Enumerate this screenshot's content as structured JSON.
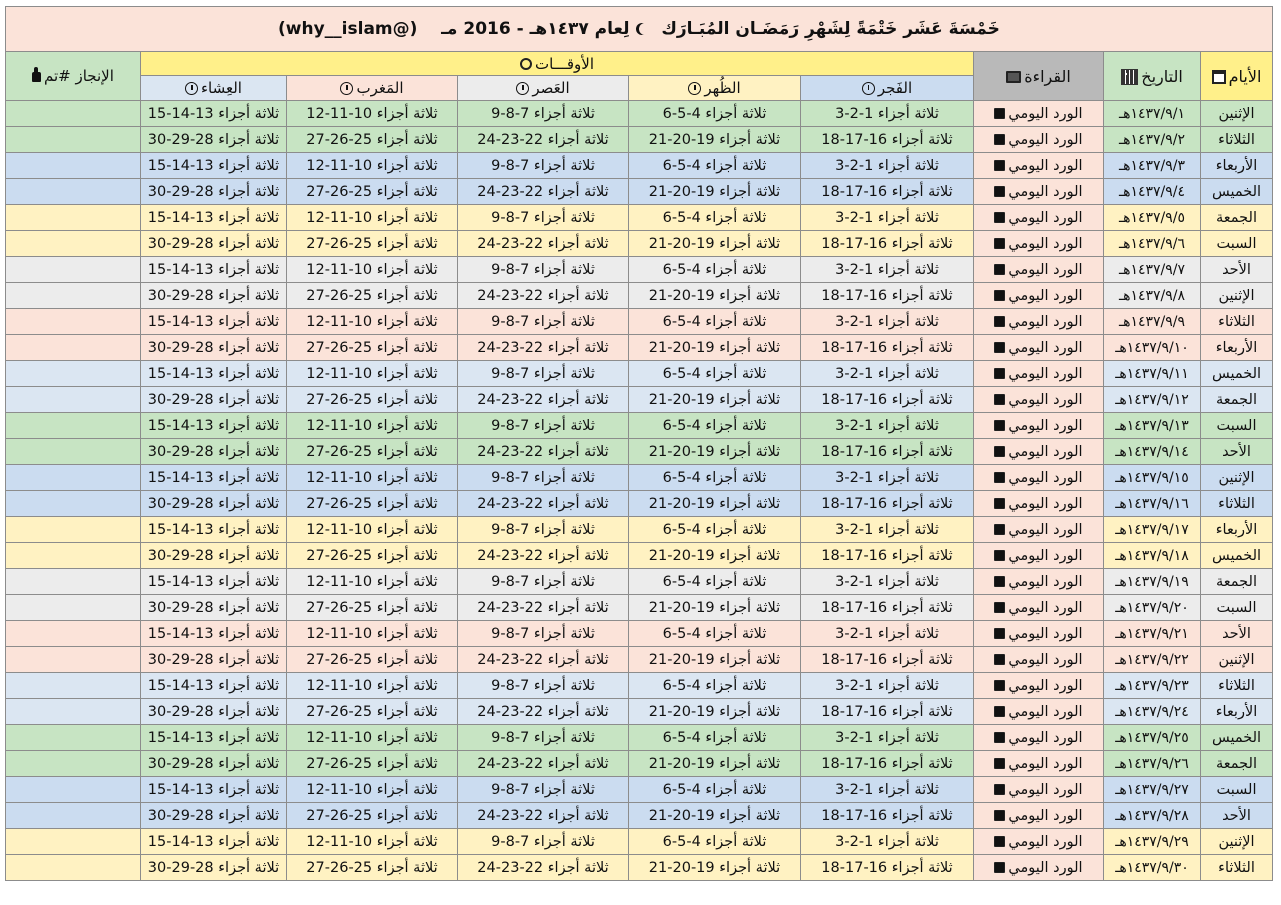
{
  "title": {
    "arabic": "خَمْسَةَ عَشَر خَتْمَةً لِشَهْرِ رَمَضَـان المُبَـارَك",
    "year_text": "لِعام ١٤٣٧هـ - 2016 مـ",
    "handle": "(@why__islam)"
  },
  "headers": {
    "day": "الأيام",
    "date": "التاريخ",
    "reading": "القراءة",
    "times": "الأوقـــات",
    "done": "الإنجاز #تم",
    "fajr": "الفَجر",
    "dhuhr": "الظُهر",
    "asr": "العَصر",
    "maghrib": "المَغرب",
    "isha": "العِشاء"
  },
  "reading_label": "الورد اليومي",
  "odd_row": {
    "fajr": "ثلاثة أجزاء 1-2-3",
    "dhuhr": "ثلاثة أجزاء 4-5-6",
    "asr": "ثلاثة أجزاء 7-8-9",
    "maghrib": "ثلاثة أجزاء 10-11-12",
    "isha": "ثلاثة أجزاء 13-14-15"
  },
  "even_row": {
    "fajr": "ثلاثة أجزاء 16-17-18",
    "dhuhr": "ثلاثة أجزاء 19-20-21",
    "asr": "ثلاثة أجزاء 22-23-24",
    "maghrib": "ثلاثة أجزاء 25-26-27",
    "isha": "ثلاثة أجزاء 28-29-30"
  },
  "rows": [
    {
      "day": "الإثنين",
      "date": "١٤٣٧/٩/١هـ"
    },
    {
      "day": "الثلاثاء",
      "date": "١٤٣٧/٩/٢هـ"
    },
    {
      "day": "الأربعاء",
      "date": "١٤٣٧/٩/٣هـ"
    },
    {
      "day": "الخميس",
      "date": "١٤٣٧/٩/٤هـ"
    },
    {
      "day": "الجمعة",
      "date": "١٤٣٧/٩/٥هـ"
    },
    {
      "day": "السبت",
      "date": "١٤٣٧/٩/٦هـ"
    },
    {
      "day": "الأحد",
      "date": "١٤٣٧/٩/٧هـ"
    },
    {
      "day": "الإثنين",
      "date": "١٤٣٧/٩/٨هـ"
    },
    {
      "day": "الثلاثاء",
      "date": "١٤٣٧/٩/٩هـ"
    },
    {
      "day": "الأربعاء",
      "date": "١٤٣٧/٩/١٠هـ"
    },
    {
      "day": "الخميس",
      "date": "١٤٣٧/٩/١١هـ"
    },
    {
      "day": "الجمعة",
      "date": "١٤٣٧/٩/١٢هـ"
    },
    {
      "day": "السبت",
      "date": "١٤٣٧/٩/١٣هـ"
    },
    {
      "day": "الأحد",
      "date": "١٤٣٧/٩/١٤هـ"
    },
    {
      "day": "الإثنين",
      "date": "١٤٣٧/٩/١٥هـ"
    },
    {
      "day": "الثلاثاء",
      "date": "١٤٣٧/٩/١٦هـ"
    },
    {
      "day": "الأربعاء",
      "date": "١٤٣٧/٩/١٧هـ"
    },
    {
      "day": "الخميس",
      "date": "١٤٣٧/٩/١٨هـ"
    },
    {
      "day": "الجمعة",
      "date": "١٤٣٧/٩/١٩هـ"
    },
    {
      "day": "السبت",
      "date": "١٤٣٧/٩/٢٠هـ"
    },
    {
      "day": "الأحد",
      "date": "١٤٣٧/٩/٢١هـ"
    },
    {
      "day": "الإثنين",
      "date": "١٤٣٧/٩/٢٢هـ"
    },
    {
      "day": "الثلاثاء",
      "date": "١٤٣٧/٩/٢٣هـ"
    },
    {
      "day": "الأربعاء",
      "date": "١٤٣٧/٩/٢٤هـ"
    },
    {
      "day": "الخميس",
      "date": "١٤٣٧/٩/٢٥هـ"
    },
    {
      "day": "الجمعة",
      "date": "١٤٣٧/٩/٢٦هـ"
    },
    {
      "day": "السبت",
      "date": "١٤٣٧/٩/٢٧هـ"
    },
    {
      "day": "الأحد",
      "date": "١٤٣٧/٩/٢٨هـ"
    },
    {
      "day": "الإثنين",
      "date": "١٤٣٧/٩/٢٩هـ"
    },
    {
      "day": "الثلاثاء",
      "date": "١٤٣٧/٩/٣٠هـ"
    }
  ]
}
